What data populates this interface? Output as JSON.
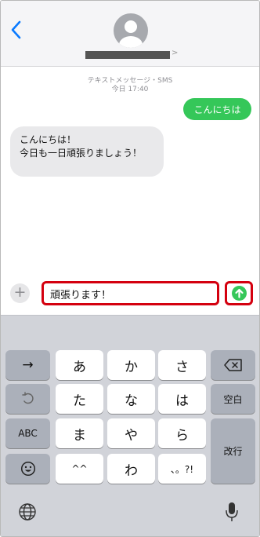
{
  "header": {
    "contact_name": "",
    "contact_chevron": ">"
  },
  "thread": {
    "service_label": "テキストメッセージ・SMS",
    "timestamp": "今日 17:40",
    "messages": [
      {
        "direction": "outgoing",
        "text": "こんにちは"
      },
      {
        "direction": "incoming",
        "lines": [
          "こんにちは！",
          "今日も一日頑張りましょう！"
        ]
      }
    ]
  },
  "composer": {
    "plus_label": "+",
    "input_value": "頑張ります！",
    "send_icon": "arrow-up-icon"
  },
  "keyboard": {
    "row1": [
      "→",
      "あ",
      "か",
      "さ"
    ],
    "row2": [
      "",
      "た",
      "な",
      "は",
      "空白"
    ],
    "row3": [
      "ABC",
      "ま",
      "や",
      "ら",
      "改行"
    ],
    "row4": [
      "",
      "^^",
      "わ",
      "、。?!"
    ],
    "icons": {
      "undo": "undo-icon",
      "delete": "delete-backspace-icon",
      "emoji": "emoji-icon",
      "globe": "globe-icon",
      "mic": "microphone-icon"
    }
  },
  "colors": {
    "imessage_green": "#35c759",
    "highlight_red": "#d4000f",
    "ios_blue": "#0a7aff",
    "incoming_bubble": "#e9e9eb",
    "keyboard_bg": "#d1d3d9"
  }
}
